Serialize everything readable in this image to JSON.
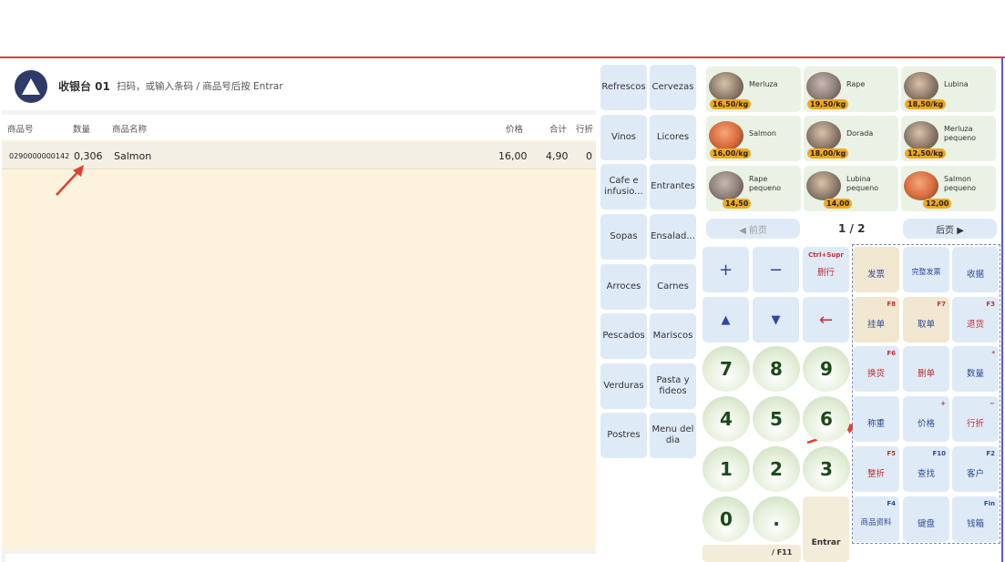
{
  "header": {
    "station": "收银台 01",
    "hint": "扫码，或输入条码 / 商品号后按 Entrar"
  },
  "columns": {
    "code": "商品号",
    "qty": "数量",
    "name": "商品名称",
    "price": "价格",
    "total": "合计",
    "line": "行折"
  },
  "ticket": [
    {
      "code": "0290000000142",
      "qty": "0,306",
      "name": "Salmon",
      "price": "16,00",
      "total": "4,90",
      "disc": "0"
    }
  ],
  "categories": [
    "Refrescos",
    "Cervezas",
    "Vinos",
    "Licores",
    "Cafe e infusio...",
    "Entrantes",
    "Sopas",
    "Ensalad...",
    "Arroces",
    "Carnes",
    "Pescados",
    "Mariscos",
    "Verduras",
    "Pasta y fideos",
    "Postres",
    "Menu del dia"
  ],
  "products": [
    {
      "name": "Merluza",
      "price": "16,50/kg",
      "img": "merluza-image"
    },
    {
      "name": "Rape",
      "price": "19,50/kg",
      "img": "rape-image"
    },
    {
      "name": "Lubina",
      "price": "18,50/kg",
      "img": "lubina-image"
    },
    {
      "name": "Salmon",
      "price": "16,00/kg",
      "img": "salmon-image"
    },
    {
      "name": "Dorada",
      "price": "18,00/kg",
      "img": "dorada-image"
    },
    {
      "name": "Merluza pequeno",
      "price": "12,50/kg",
      "img": "merluza-image"
    },
    {
      "name": "Rape pequeno",
      "price": "14,50",
      "img": "rape-image"
    },
    {
      "name": "Lubina pequeno",
      "price": "14,00",
      "img": "lubina-image"
    },
    {
      "name": "Salmon pequeno",
      "price": "12,00",
      "img": "salmon-image"
    }
  ],
  "pager": {
    "prev": "◀ 前页",
    "page": "1 / 2",
    "next": "后页 ▶"
  },
  "keypad": {
    "plus": "+",
    "minus": "−",
    "del_line": "删行",
    "del_line_shortcut": "Ctrl+Supr",
    "up": "▲",
    "down": "▼",
    "backspace": "←",
    "digits": [
      "7",
      "8",
      "9",
      "4",
      "5",
      "6",
      "1",
      "2",
      "3",
      "0",
      "."
    ],
    "enter": "Entrar",
    "bottom_label": "/ F11"
  },
  "functions": [
    {
      "label": "发票",
      "shortcut": ""
    },
    {
      "label": "完整发票",
      "shortcut": ""
    },
    {
      "label": "收据",
      "shortcut": ""
    },
    {
      "label": "挂单",
      "shortcut": "F8"
    },
    {
      "label": "取单",
      "shortcut": "F7"
    },
    {
      "label": "退货",
      "shortcut": "F3"
    },
    {
      "label": "换货",
      "shortcut": "F6"
    },
    {
      "label": "删单",
      "shortcut": ""
    },
    {
      "label": "数量",
      "shortcut": "*"
    },
    {
      "label": "称重",
      "shortcut": ""
    },
    {
      "label": "价格",
      "shortcut": "+"
    },
    {
      "label": "行折",
      "shortcut": "−"
    },
    {
      "label": "整折",
      "shortcut": "F5"
    },
    {
      "label": "查找",
      "shortcut": "F10"
    },
    {
      "label": "客户",
      "shortcut": "F2"
    },
    {
      "label": "商品资料",
      "shortcut": "F4"
    },
    {
      "label": "键盘",
      "shortcut": ""
    },
    {
      "label": "钱箱",
      "shortcut": "Fin"
    }
  ],
  "colors": {
    "accent_red": "#d94040",
    "category_bg": "#dfeaf7",
    "product_bg": "#e9f2e4",
    "price_tag": "#f0a91e",
    "ticket_bg": "#fdf3dd"
  }
}
